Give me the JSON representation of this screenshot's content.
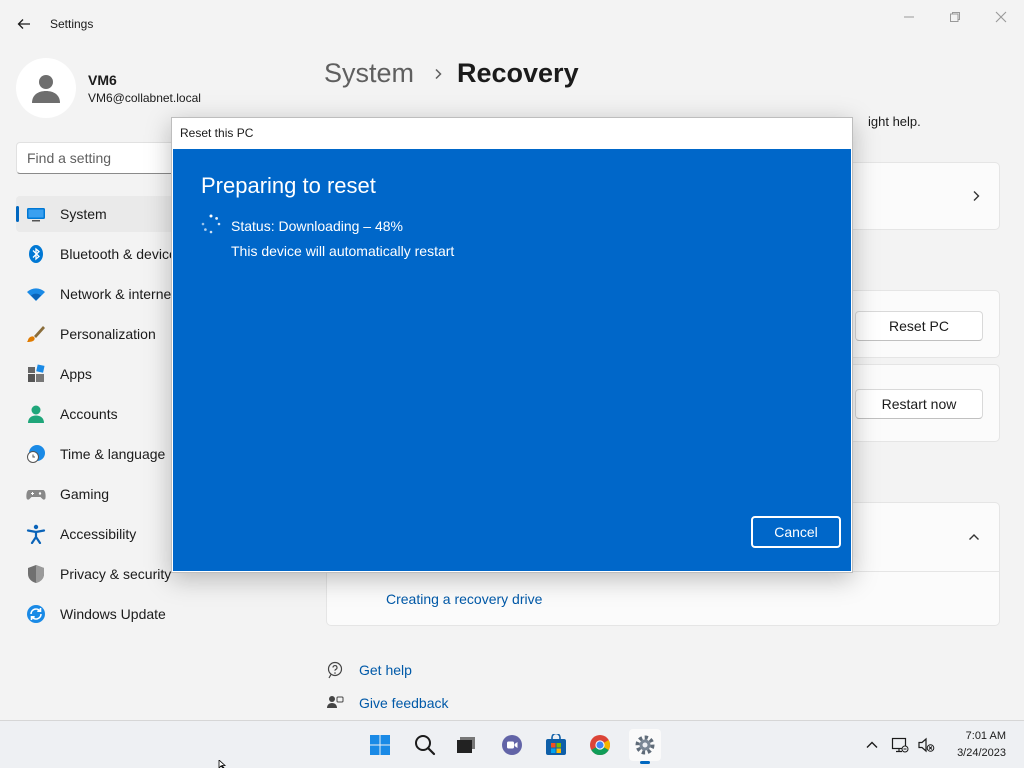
{
  "window": {
    "title": "Settings"
  },
  "user": {
    "name": "VM6",
    "email": "VM6@collabnet.local"
  },
  "search": {
    "placeholder": "Find a setting"
  },
  "sidebar": {
    "items": [
      {
        "label": "System",
        "icon": "monitor-icon",
        "active": true
      },
      {
        "label": "Bluetooth & devices",
        "icon": "bluetooth-icon"
      },
      {
        "label": "Network & internet",
        "icon": "wifi-icon"
      },
      {
        "label": "Personalization",
        "icon": "brush-icon"
      },
      {
        "label": "Apps",
        "icon": "apps-icon"
      },
      {
        "label": "Accounts",
        "icon": "person-icon"
      },
      {
        "label": "Time & language",
        "icon": "globe-clock-icon"
      },
      {
        "label": "Gaming",
        "icon": "gamepad-icon"
      },
      {
        "label": "Accessibility",
        "icon": "accessibility-icon"
      },
      {
        "label": "Privacy & security",
        "icon": "shield-icon"
      },
      {
        "label": "Windows Update",
        "icon": "update-icon"
      }
    ]
  },
  "main": {
    "breadcrumb_parent": "System",
    "breadcrumb_page": "Recovery",
    "description_visible": "ight help.",
    "reset_button": "Reset PC",
    "restart_button": "Restart now",
    "recovery_drive_link": "Creating a recovery drive",
    "get_help": "Get help",
    "give_feedback": "Give feedback"
  },
  "dialog": {
    "title": "Reset this PC",
    "heading": "Preparing to reset",
    "status": "Status: Downloading – 48%",
    "note": "This device will automatically restart",
    "cancel": "Cancel"
  },
  "taskbar": {
    "apps": [
      "start-icon",
      "search-icon",
      "task-view-icon",
      "teams-chat-icon",
      "store-icon",
      "chrome-icon",
      "settings-gear-icon"
    ],
    "time": "7:01 AM",
    "date": "3/24/2023"
  },
  "colors": {
    "accent": "#0067c0",
    "dialog_blue": "#0067c9",
    "link": "#0059a8"
  }
}
